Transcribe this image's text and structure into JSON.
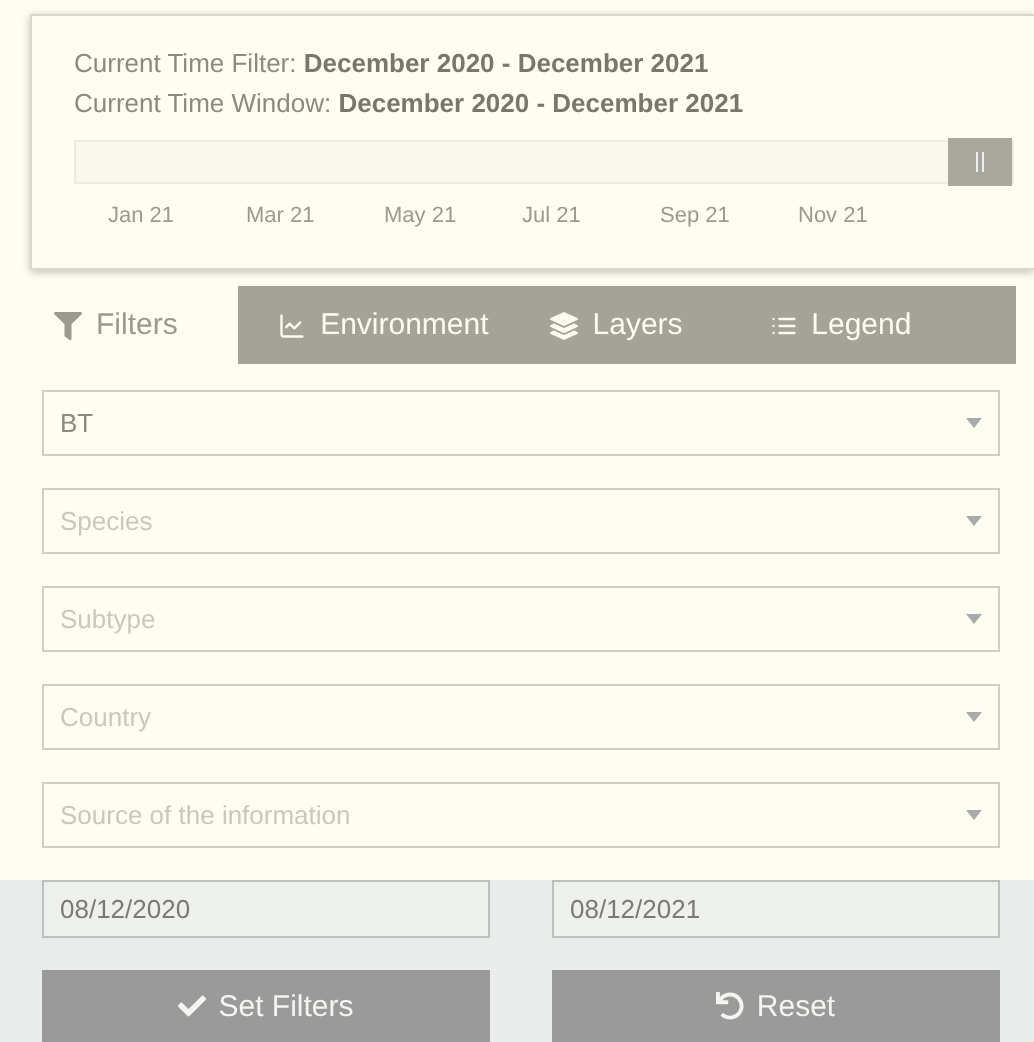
{
  "time_panel": {
    "filter_label": "Current Time Filter:",
    "filter_value": "December 2020 - December 2021",
    "window_label": "Current Time Window:",
    "window_value": "December 2020 - December 2021",
    "slider": {
      "level": 1
    },
    "ticks": [
      "Jan 21",
      "Mar 21",
      "May 21",
      "Jul 21",
      "Sep 21",
      "Nov 21"
    ]
  },
  "tabs": [
    {
      "label": "Filters",
      "selected": true
    },
    {
      "label": "Environment",
      "selected": false
    },
    {
      "label": "Layers",
      "selected": false
    },
    {
      "label": "Legend",
      "selected": false
    }
  ],
  "filters": [
    {
      "value": "BT"
    },
    {
      "placeholder": "Species"
    },
    {
      "placeholder": "Subtype"
    },
    {
      "placeholder": "Country"
    },
    {
      "placeholder": "Source of the information"
    }
  ],
  "dates": [
    "08/12/2020",
    "08/12/2021"
  ],
  "buttons": [
    {
      "label": "Set Filters"
    },
    {
      "label": "Reset"
    }
  ]
}
